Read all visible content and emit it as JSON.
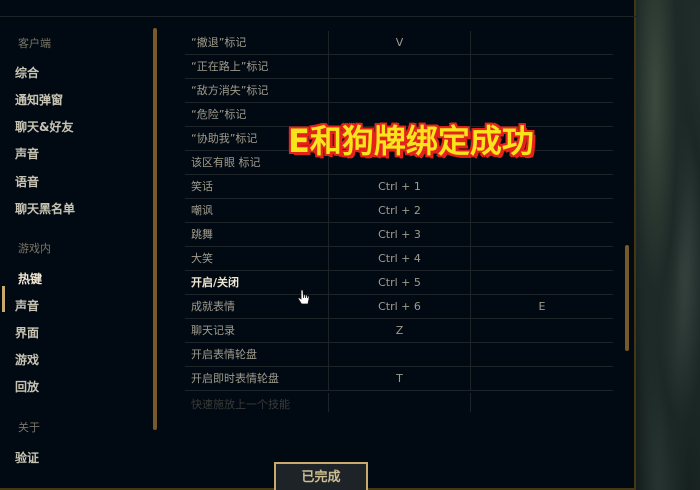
{
  "sidebar": {
    "section_client": "客户端",
    "client_items": [
      "综合",
      "通知弹窗",
      "聊天&好友",
      "声音",
      "语音",
      "聊天黑名单"
    ],
    "section_ingame": "游戏内",
    "ingame_items": [
      "热键",
      "声音",
      "界面",
      "游戏",
      "回放"
    ],
    "active_item": "热键",
    "section_about": "关于",
    "about_items": [
      "验证"
    ]
  },
  "table": {
    "rows": [
      {
        "name": "“撤退”标记",
        "key1": "V",
        "key2": ""
      },
      {
        "name": "“正在路上”标记",
        "key1": "",
        "key2": ""
      },
      {
        "name": "“敌方消失”标记",
        "key1": "",
        "key2": ""
      },
      {
        "name": "“危险”标记",
        "key1": "",
        "key2": ""
      },
      {
        "name": "“协助我”标记",
        "key1": "",
        "key2": ""
      },
      {
        "name": "该区有眼 标记",
        "key1": "",
        "key2": ""
      },
      {
        "name": "笑话",
        "key1": "Ctrl + 1",
        "key2": ""
      },
      {
        "name": "嘲讽",
        "key1": "Ctrl + 2",
        "key2": ""
      },
      {
        "name": "跳舞",
        "key1": "Ctrl + 3",
        "key2": ""
      },
      {
        "name": "大笑",
        "key1": "Ctrl + 4",
        "key2": ""
      },
      {
        "name": "开启/关闭",
        "key1": "Ctrl + 5",
        "key2": ""
      },
      {
        "name": "成就表情",
        "key1": "Ctrl + 6",
        "key2": "E"
      },
      {
        "name": "聊天记录",
        "key1": "Z",
        "key2": ""
      },
      {
        "name": "开启表情轮盘",
        "key1": "",
        "key2": ""
      },
      {
        "name": "开启即时表情轮盘",
        "key1": "T",
        "key2": ""
      },
      {
        "name": "快速施放上一个技能",
        "key1": "",
        "key2": ""
      }
    ]
  },
  "overlay": {
    "caption": "E和狗牌绑定成功"
  },
  "footer": {
    "done_label": "已完成"
  },
  "colors": {
    "accent_gold": "#c8aa6e",
    "caption_yellow": "#f7e51c",
    "caption_outline": "#e4231b"
  },
  "icons": {
    "cursor": "mouse-pointer-hand-icon"
  }
}
